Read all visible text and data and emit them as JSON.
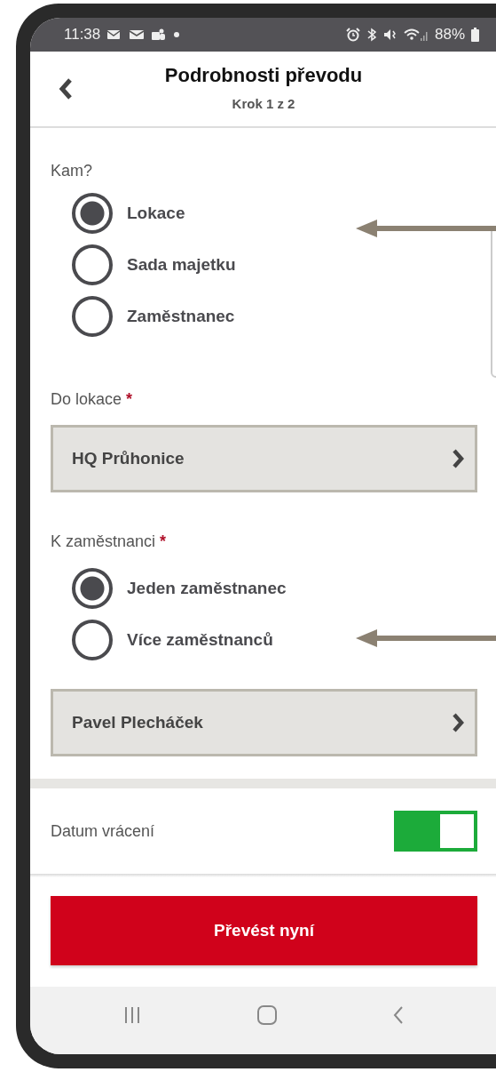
{
  "status_bar": {
    "time": "11:38",
    "battery": "88%"
  },
  "header": {
    "title": "Podrobnosti převodu",
    "subtitle": "Krok 1 z 2"
  },
  "destination": {
    "label": "Kam?",
    "options": [
      {
        "label": "Lokace",
        "selected": true
      },
      {
        "label": "Sada majetku",
        "selected": false
      },
      {
        "label": "Zaměstnanec",
        "selected": false
      }
    ]
  },
  "location_field": {
    "label": "Do lokace",
    "required_mark": "*",
    "value": "HQ Průhonice"
  },
  "employee": {
    "label": "K zaměstnanci",
    "required_mark": "*",
    "options": [
      {
        "label": "Jeden zaměstnanec",
        "selected": true
      },
      {
        "label": "Více zaměstnanců",
        "selected": false
      }
    ],
    "value": "Pavel Plecháček"
  },
  "return_date": {
    "label": "Datum vrácení",
    "on": true
  },
  "primary_button": "Převést nyní"
}
